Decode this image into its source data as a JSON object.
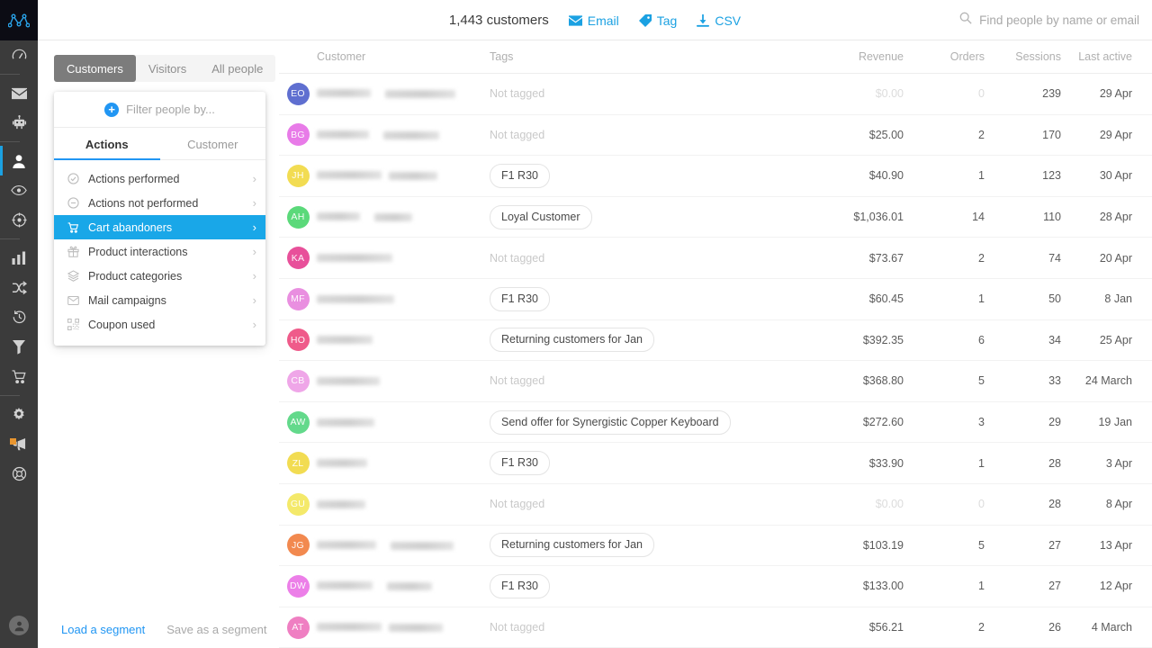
{
  "app": {
    "logo_name": "metrilo-logo"
  },
  "rail": {
    "items": [
      {
        "name": "dashboard",
        "icon": "speedometer-icon",
        "active": false,
        "sep_after": true
      },
      {
        "name": "email",
        "icon": "envelope-icon",
        "active": false,
        "sep_after": false
      },
      {
        "name": "automation",
        "icon": "robot-icon",
        "active": false,
        "sep_after": true
      },
      {
        "name": "people",
        "icon": "person-icon",
        "active": true,
        "sep_after": false
      },
      {
        "name": "live-view",
        "icon": "eye-icon",
        "active": false,
        "sep_after": false
      },
      {
        "name": "targeting",
        "icon": "crosshair-icon",
        "active": false,
        "sep_after": true
      },
      {
        "name": "analytics",
        "icon": "bar-chart-icon",
        "active": false,
        "sep_after": false
      },
      {
        "name": "funnels",
        "icon": "shuffle-icon",
        "active": false,
        "sep_after": false
      },
      {
        "name": "retention",
        "icon": "history-icon",
        "active": false,
        "sep_after": false
      },
      {
        "name": "segments",
        "icon": "funnel-icon",
        "active": false,
        "sep_after": false
      },
      {
        "name": "orders",
        "icon": "cart-icon",
        "active": false,
        "sep_after": true
      },
      {
        "name": "settings",
        "icon": "gear-icon",
        "active": false,
        "sep_after": false
      },
      {
        "name": "announcements",
        "icon": "megaphone-icon",
        "active": false,
        "sep_after": false,
        "badge": true
      },
      {
        "name": "help",
        "icon": "lifebuoy-icon",
        "active": false,
        "sep_after": false
      }
    ],
    "account_icon": "user-avatar-icon"
  },
  "topbar": {
    "customer_count": "1,443 customers",
    "actions": [
      {
        "label": "Email",
        "icon": "envelope-icon"
      },
      {
        "label": "Tag",
        "icon": "tag-icon"
      },
      {
        "label": "CSV",
        "icon": "download-icon"
      }
    ],
    "search": {
      "placeholder": "Find people by name or email",
      "value": "",
      "icon": "search-icon"
    }
  },
  "left_panel": {
    "segment_tabs": [
      {
        "label": "Customers",
        "active": true
      },
      {
        "label": "Visitors",
        "active": false
      },
      {
        "label": "All people",
        "active": false
      }
    ],
    "filter_header": {
      "label": "Filter people by...",
      "icon": "plus-circle-icon"
    },
    "panel_tabs": [
      {
        "label": "Actions",
        "active": true
      },
      {
        "label": "Customer",
        "active": false
      }
    ],
    "filter_items": [
      {
        "label": "Actions performed",
        "icon": "check-circle-icon",
        "selected": false
      },
      {
        "label": "Actions not performed",
        "icon": "minus-circle-icon",
        "selected": false
      },
      {
        "label": "Cart abandoners",
        "icon": "cart-icon",
        "selected": true
      },
      {
        "label": "Product interactions",
        "icon": "gift-icon",
        "selected": false
      },
      {
        "label": "Product categories",
        "icon": "layers-icon",
        "selected": false
      },
      {
        "label": "Mail campaigns",
        "icon": "envelope-icon",
        "selected": false
      },
      {
        "label": "Coupon used",
        "icon": "barcode-icon",
        "selected": false
      }
    ],
    "segment_actions": [
      {
        "label": "Load a segment",
        "muted": false
      },
      {
        "label": "Save as a segment",
        "muted": true
      }
    ]
  },
  "table": {
    "columns": [
      {
        "key": "customer",
        "label": "Customer"
      },
      {
        "key": "tags",
        "label": "Tags"
      },
      {
        "key": "revenue",
        "label": "Revenue"
      },
      {
        "key": "orders",
        "label": "Orders"
      },
      {
        "key": "sessions",
        "label": "Sessions"
      },
      {
        "key": "last",
        "label": "Last active"
      }
    ],
    "not_tagged_label": "Not tagged",
    "rows": [
      {
        "initials": "EO",
        "color": "#5f6fd0",
        "name_redacted": true,
        "tag": null,
        "revenue": "$0.00",
        "revenue_zero": true,
        "orders": "0",
        "orders_zero": true,
        "sessions": "239",
        "last_active": "29 Apr"
      },
      {
        "initials": "BG",
        "color": "#e87be8",
        "name_redacted": true,
        "tag": null,
        "revenue": "$25.00",
        "revenue_zero": false,
        "orders": "2",
        "orders_zero": false,
        "sessions": "170",
        "last_active": "29 Apr"
      },
      {
        "initials": "JH",
        "color": "#f2dc52",
        "name_redacted": true,
        "tag": "F1 R30",
        "revenue": "$40.90",
        "revenue_zero": false,
        "orders": "1",
        "orders_zero": false,
        "sessions": "123",
        "last_active": "30 Apr"
      },
      {
        "initials": "AH",
        "color": "#5bd97a",
        "name_redacted": true,
        "tag": "Loyal Customer",
        "revenue": "$1,036.01",
        "revenue_zero": false,
        "orders": "14",
        "orders_zero": false,
        "sessions": "110",
        "last_active": "28 Apr"
      },
      {
        "initials": "KA",
        "color": "#e8509a",
        "name_redacted": true,
        "tag": null,
        "revenue": "$73.67",
        "revenue_zero": false,
        "orders": "2",
        "orders_zero": false,
        "sessions": "74",
        "last_active": "20 Apr"
      },
      {
        "initials": "MF",
        "color": "#e98fe0",
        "name_redacted": true,
        "tag": "F1 R30",
        "revenue": "$60.45",
        "revenue_zero": false,
        "orders": "1",
        "orders_zero": false,
        "sessions": "50",
        "last_active": "8 Jan"
      },
      {
        "initials": "HO",
        "color": "#ef5b8a",
        "name_redacted": true,
        "tag": "Returning customers for Jan",
        "revenue": "$392.35",
        "revenue_zero": false,
        "orders": "6",
        "orders_zero": false,
        "sessions": "34",
        "last_active": "25 Apr"
      },
      {
        "initials": "CB",
        "color": "#efa6e8",
        "name_redacted": true,
        "tag": null,
        "revenue": "$368.80",
        "revenue_zero": false,
        "orders": "5",
        "orders_zero": false,
        "sessions": "33",
        "last_active": "24 March"
      },
      {
        "initials": "AW",
        "color": "#63d98b",
        "name_redacted": true,
        "tag": "Send offer for Synergistic Copper Keyboard",
        "revenue": "$272.60",
        "revenue_zero": false,
        "orders": "3",
        "orders_zero": false,
        "sessions": "29",
        "last_active": "19 Jan"
      },
      {
        "initials": "ZL",
        "color": "#f2dc52",
        "name_redacted": true,
        "tag": "F1 R30",
        "revenue": "$33.90",
        "revenue_zero": false,
        "orders": "1",
        "orders_zero": false,
        "sessions": "28",
        "last_active": "3 Apr"
      },
      {
        "initials": "GU",
        "color": "#f4e96a",
        "name_redacted": true,
        "tag": null,
        "revenue": "$0.00",
        "revenue_zero": true,
        "orders": "0",
        "orders_zero": true,
        "sessions": "28",
        "last_active": "8 Apr"
      },
      {
        "initials": "JG",
        "color": "#f2894f",
        "name_redacted": true,
        "tag": "Returning customers for Jan",
        "revenue": "$103.19",
        "revenue_zero": false,
        "orders": "5",
        "orders_zero": false,
        "sessions": "27",
        "last_active": "13 Apr"
      },
      {
        "initials": "DW",
        "color": "#ec7fe8",
        "name_redacted": true,
        "tag": "F1 R30",
        "revenue": "$133.00",
        "revenue_zero": false,
        "orders": "1",
        "orders_zero": false,
        "sessions": "27",
        "last_active": "12 Apr"
      },
      {
        "initials": "AT",
        "color": "#ef7fc2",
        "name_redacted": true,
        "tag": null,
        "revenue": "$56.21",
        "revenue_zero": false,
        "orders": "2",
        "orders_zero": false,
        "sessions": "26",
        "last_active": "4 March"
      }
    ]
  },
  "colors": {
    "accent_blue": "#1ba1e2",
    "selection_blue": "#19a7e8",
    "rail_bg": "#3b3b3b",
    "logo_bg": "#0c0c14"
  }
}
